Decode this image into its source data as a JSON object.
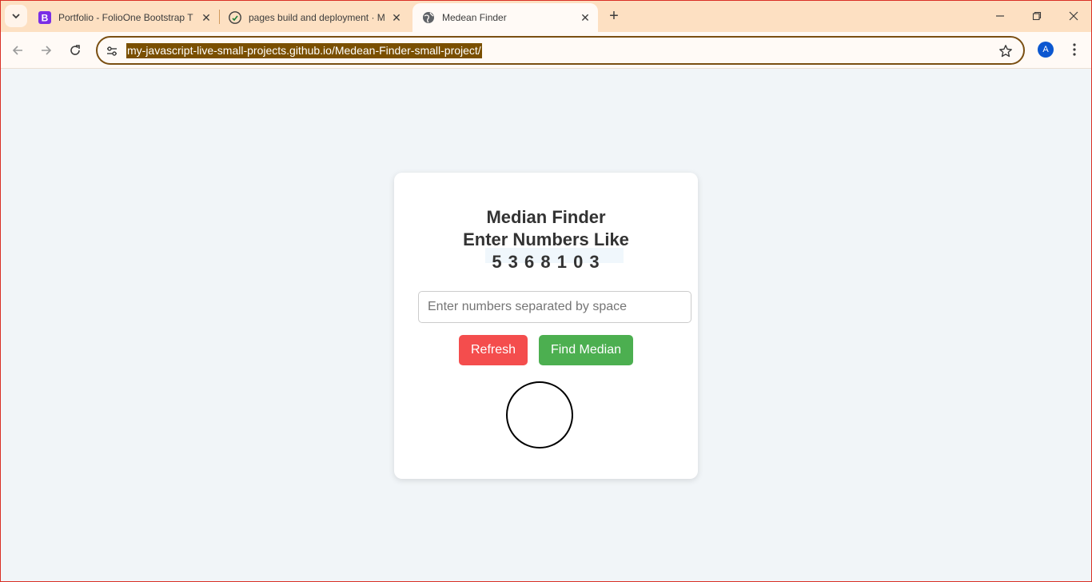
{
  "browser": {
    "tabs": [
      {
        "title": "Portfolio - FolioOne Bootstrap T",
        "favicon": "bootstrap-icon"
      },
      {
        "title": "pages build and deployment · M",
        "favicon": "github-icon"
      },
      {
        "title": "Medean Finder",
        "favicon": "globe-icon",
        "active": true
      }
    ],
    "address": {
      "url": "my-javascript-live-small-projects.github.io/Medean-Finder-small-project/"
    },
    "profile_initial": "A",
    "colors": {
      "tabstrip": "#fde0c2",
      "toolbar": "#fffaf6",
      "omnibox_border": "#7a4f12",
      "url_highlight": "#7a4f00",
      "avatar": "#0b57d0"
    }
  },
  "app": {
    "title_line1": "Median Finder",
    "title_line2": "Enter Numbers Like",
    "example": "5 3 6 8 1 0 3",
    "input_placeholder": "Enter numbers separated by space",
    "input_value": "",
    "refresh_label": "Refresh",
    "find_label": "Find Median",
    "result": "",
    "colors": {
      "refresh": "#f44d4d",
      "find": "#4caf50",
      "background": "#f1f5f8",
      "card": "#ffffff",
      "text": "#333333"
    }
  }
}
